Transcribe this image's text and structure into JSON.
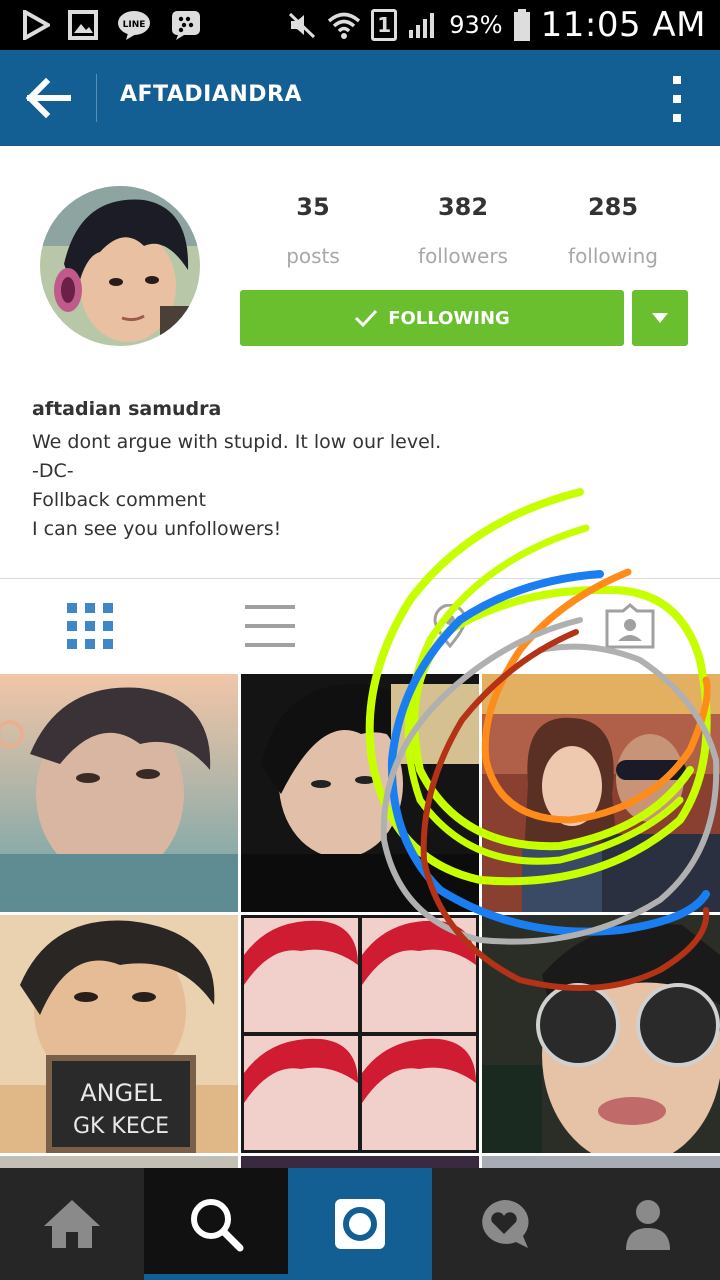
{
  "status_bar": {
    "time": "11:05 AM",
    "battery_percent": "93%",
    "sim_slot": "1",
    "icons": [
      "play-store-icon",
      "gallery-icon",
      "line-app-icon",
      "bbm-icon",
      "mute-icon",
      "wifi-icon",
      "sim-icon",
      "signal-icon",
      "battery-icon"
    ]
  },
  "app_bar": {
    "title": "AFTADIANDRA",
    "back_icon": "arrow-left-icon",
    "overflow_icon": "more-vert-icon"
  },
  "profile": {
    "stats": [
      {
        "value": "35",
        "label": "posts"
      },
      {
        "value": "382",
        "label": "followers"
      },
      {
        "value": "285",
        "label": "following"
      }
    ],
    "follow_button_label": "FOLLOWING",
    "bio_name": "aftadian samudra",
    "bio_lines": [
      "We dont argue with stupid. It low our level.",
      "-DC-",
      "Follback comment",
      "I can see you unfollowers!"
    ]
  },
  "tabs": [
    {
      "name": "grid-view",
      "icon": "grid-icon",
      "active": true
    },
    {
      "name": "list-view",
      "icon": "list-icon",
      "active": false
    },
    {
      "name": "map-view",
      "icon": "location-icon",
      "active": false
    },
    {
      "name": "tagged-view",
      "icon": "person-tag-icon",
      "active": false
    }
  ],
  "photo_overlay_text": {
    "chalkboard": [
      "ANGEL",
      "GK KECE"
    ]
  },
  "bottom_nav": [
    {
      "name": "home",
      "icon": "home-icon",
      "active": false
    },
    {
      "name": "explore",
      "icon": "search-icon",
      "active": true
    },
    {
      "name": "camera",
      "icon": "camera-icon",
      "active": false
    },
    {
      "name": "activity",
      "icon": "heart-bubble-icon",
      "active": false
    },
    {
      "name": "profile",
      "icon": "person-icon",
      "active": false
    }
  ],
  "colors": {
    "app_bar": "#135f94",
    "follow_green": "#6abf2f",
    "tab_active": "#3f87c6",
    "nav_bg": "#262626",
    "scribble": [
      "#c6ff00",
      "#1a7ef0",
      "#ff8c1a",
      "#b0b0b0",
      "#b43216"
    ]
  }
}
